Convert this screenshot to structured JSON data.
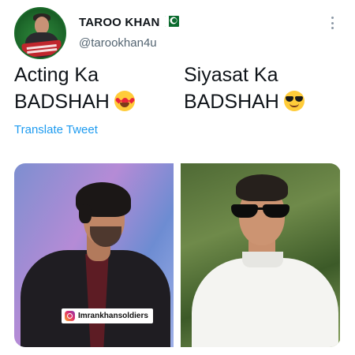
{
  "author": {
    "display_name": "TAROO KHAN",
    "handle": "@tarookhan4u",
    "flag_icon": "pakistan-flag-icon",
    "avatar_icon": "profile-avatar"
  },
  "tweet": {
    "left_column": {
      "line1": "Acting Ka",
      "line2": "BADSHAH",
      "emoji": "heart-eyes-emoji"
    },
    "right_column": {
      "line1": "Siyasat Ka",
      "line2": "BADSHAH",
      "emoji": "sunglasses-emoji"
    },
    "translate_label": "Translate Tweet"
  },
  "media": {
    "photo_count": 2,
    "watermark": {
      "icon": "instagram-icon",
      "text": "Imrankhansoldiers"
    }
  },
  "colors": {
    "link": "#1d9bf0",
    "text": "#0f1419",
    "secondary_text": "#536471"
  }
}
